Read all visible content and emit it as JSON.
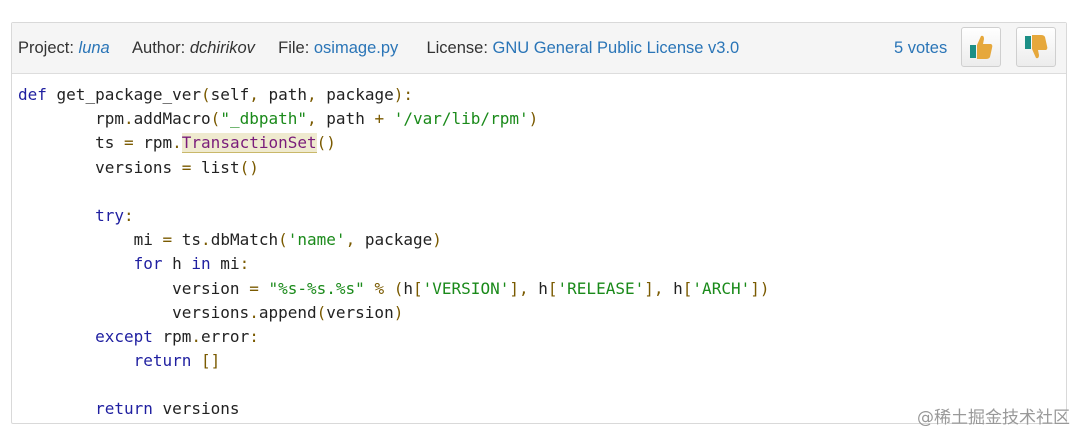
{
  "header": {
    "project_label": "Project:",
    "project_value": "luna",
    "author_label": "Author:",
    "author_value": "dchirikov",
    "file_label": "File:",
    "file_value": "osimage.py",
    "license_label": "License:",
    "license_value": "GNU General Public License v3.0",
    "votes": "5 votes",
    "upvote_icon": "thumbs-up-icon",
    "downvote_icon": "thumbs-down-icon"
  },
  "code": {
    "lines": [
      "def get_package_ver(self, path, package):",
      "        rpm.addMacro(\"_dbpath\", path + '/var/lib/rpm')",
      "        ts = rpm.TransactionSet()",
      "        versions = list()",
      "",
      "        try:",
      "            mi = ts.dbMatch('name', package)",
      "            for h in mi:",
      "                version = \"%s-%s.%s\" % (h['VERSION'], h['RELEASE'], h['ARCH'])",
      "                versions.append(version)",
      "        except rpm.error:",
      "            return []",
      "",
      "        return versions"
    ]
  },
  "watermark": "@稀土掘金技术社区",
  "colors": {
    "link": "#2a75b7",
    "keyword": "#1f1fa0",
    "string": "#1a8a1a",
    "header_bg": "#f5f5f5"
  }
}
